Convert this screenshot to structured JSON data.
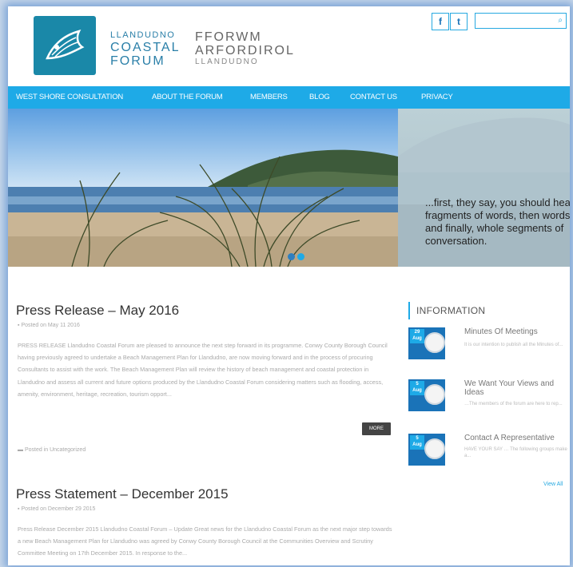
{
  "header": {
    "logo": {
      "line1": "LLANDUDNO",
      "line2": "COASTAL",
      "line3": "FORUM"
    },
    "logo_welsh": {
      "line1": "FFORWM",
      "line2": "ARFORDIROL",
      "line3": "LLANDUDNO"
    },
    "social": {
      "facebook": "f",
      "twitter": "t"
    },
    "search": {
      "placeholder": "",
      "icon": "search-icon"
    }
  },
  "nav": {
    "items": [
      "WEST SHORE CONSULTATION",
      "ABOUT THE FORUM",
      "MEMBERS",
      "BLOG",
      "CONTACT US",
      "PRIVACY"
    ]
  },
  "hero": {
    "quote": "...first, they say, you should hear fragments of words, then words, and finally, whole segments of conversation."
  },
  "posts": [
    {
      "title": "Press Release – May 2016",
      "date": "Posted on May 11 2016",
      "excerpt": "PRESS RELEASE Llandudno Coastal Forum are pleased to announce the next step forward in its programme. Conwy County Borough Council having previously agreed to undertake a Beach Management Plan for Llandudno, are now moving forward and in the process of procuring Consultants to assist with the work. The Beach Management Plan will review the history of beach management and coastal protection in Llandudno and assess all current and future options produced by the Llandudno Coastal Forum considering matters such as flooding, access, amenity, environment, heritage, recreation, tourism opport...",
      "more": "MORE",
      "category": "Posted in Uncategorized"
    },
    {
      "title": "Press Statement – December 2015",
      "date": "Posted on December 29 2015",
      "excerpt": "Press Release December 2015 Llandudno Coastal Forum – Update Great news for the Llandudno Coastal Forum as the next major step towards a new Beach Management Plan for Llandudno was agreed by Conwy County Borough Council at the Communities Overview and Scrutiny Committee Meeting on 17th December 2015. In response to the..."
    }
  ],
  "sidebar": {
    "title": "INFORMATION",
    "items": [
      {
        "day": "29",
        "month": "Aug",
        "title": "Minutes Of Meetings",
        "excerpt": "It is our intention to publish all the Minutes of..."
      },
      {
        "day": "5",
        "month": "Aug",
        "title": "We Want Your Views and Ideas",
        "excerpt": "…The members of the forum are here to rep..."
      },
      {
        "day": "5",
        "month": "Aug",
        "title": "Contact A Representative",
        "excerpt": "HAVE YOUR SAY … The following groups make a..."
      }
    ],
    "view_all": "View All"
  },
  "colors": {
    "accent": "#1eaae7",
    "logo": "#1a88a8",
    "dark_blue": "#1a73b8"
  }
}
